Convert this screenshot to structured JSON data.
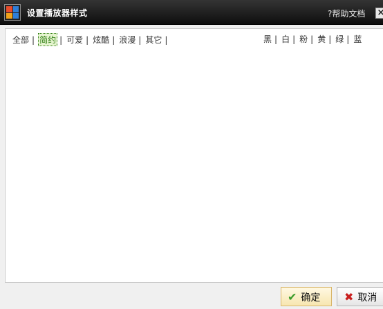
{
  "window": {
    "title": "设置播放器样式",
    "help_label": "?帮助文档",
    "close_glyph": "×"
  },
  "filters": {
    "items": [
      "全部",
      "简约",
      "可爱",
      "炫酷",
      "浪漫",
      "其它"
    ],
    "active": "简约",
    "separator": "|"
  },
  "colors": {
    "items": [
      "黑",
      "白",
      "粉",
      "黄",
      "绿",
      "蓝"
    ],
    "separator": "|"
  },
  "footer": {
    "ok_label": "确定",
    "cancel_label": "取消"
  },
  "theme": {
    "titlebar": "#1a1a1a",
    "accent_active": "#2e7d12"
  }
}
